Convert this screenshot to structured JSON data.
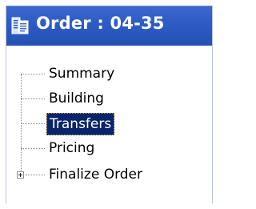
{
  "header": {
    "title": "Order : 04-35",
    "icon": "document-folder-icon"
  },
  "tree": {
    "items": [
      {
        "label": "Summary",
        "selected": false,
        "expandable": false
      },
      {
        "label": "Building",
        "selected": false,
        "expandable": false
      },
      {
        "label": "Transfers",
        "selected": true,
        "expandable": false
      },
      {
        "label": "Pricing",
        "selected": false,
        "expandable": false
      },
      {
        "label": "Finalize Order",
        "selected": false,
        "expandable": true
      }
    ]
  },
  "colors": {
    "header_bg": "#2d5bc4",
    "selection_bg": "#0a246a",
    "selection_text": "#ffffff"
  }
}
